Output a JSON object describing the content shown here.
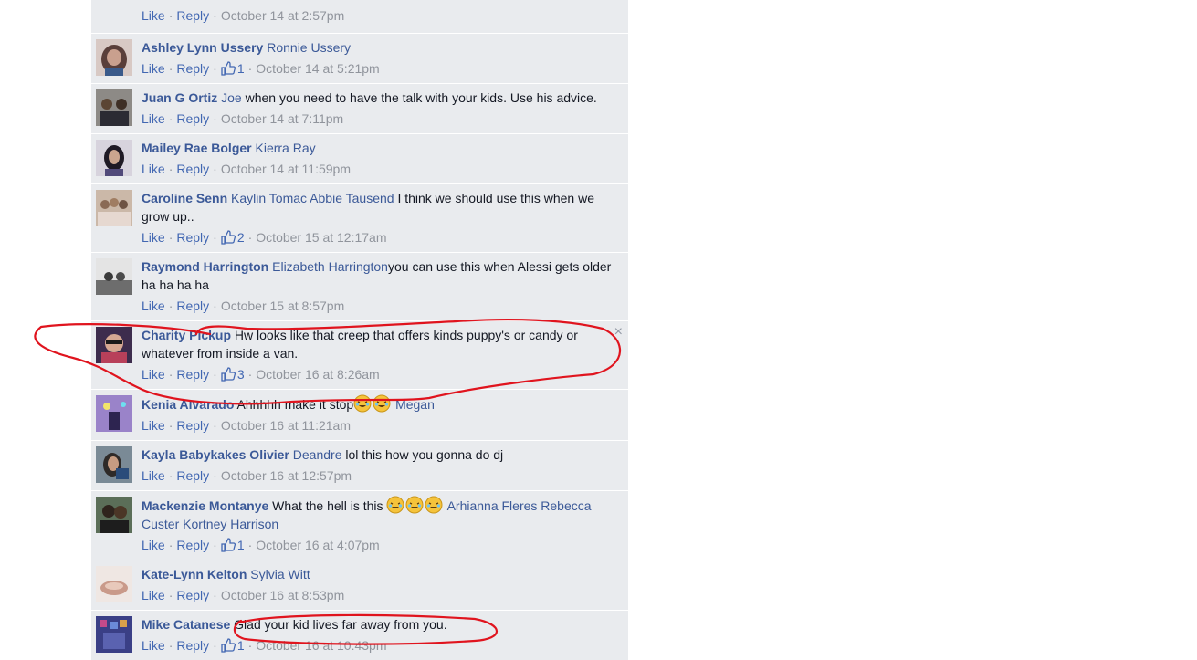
{
  "ui": {
    "like_label": "Like",
    "reply_label": "Reply",
    "separator": "·",
    "close_glyph": "×"
  },
  "comments": [
    {
      "author": "",
      "tags": [],
      "text": "",
      "likes": "",
      "timestamp": "October 14 at 2:57pm"
    },
    {
      "author": "Ashley Lynn Ussery",
      "tags": [
        "Ronnie Ussery"
      ],
      "text": "",
      "likes": "1",
      "timestamp": "October 14 at 5:21pm"
    },
    {
      "author": "Juan G Ortiz",
      "tags": [
        "Joe"
      ],
      "text": "when you need to have the talk with your kids. Use his advice.",
      "likes": "",
      "timestamp": "October 14 at 7:11pm"
    },
    {
      "author": "Mailey Rae Bolger",
      "tags": [
        "Kierra Ray"
      ],
      "text": "",
      "likes": "",
      "timestamp": "October 14 at 11:59pm"
    },
    {
      "author": "Caroline Senn",
      "tags": [
        "Kaylin Tomac",
        "Abbie Tausend"
      ],
      "text": "I think we should use this when we grow up..",
      "likes": "2",
      "timestamp": "October 15 at 12:17am"
    },
    {
      "author": "Raymond Harrington",
      "tags": [
        "Elizabeth Harrington"
      ],
      "text": "you can use this when Alessi gets older ha ha ha ha",
      "likes": "",
      "timestamp": "October 15 at 8:57pm"
    },
    {
      "author": "Charity Pickup",
      "tags": [],
      "text": "Hw looks like that creep that offers kinds puppy's or candy or whatever from inside a van.",
      "likes": "3",
      "timestamp": "October 16 at 8:26am"
    },
    {
      "author": "Kenia Alvarado",
      "tags": [],
      "text": "Ahhhhh make it stop",
      "emoji_count": 2,
      "trailing_tag": "Megan",
      "likes": "",
      "timestamp": "October 16 at 11:21am"
    },
    {
      "author": "Kayla Babykakes Olivier",
      "tags": [
        "Deandre"
      ],
      "text": "lol this how you gonna do dj",
      "likes": "",
      "timestamp": "October 16 at 12:57pm"
    },
    {
      "author": "Mackenzie Montanye",
      "tags": [],
      "text": "What the hell is this",
      "emoji_count": 3,
      "trailing_tags": [
        "Arhianna Fleres",
        "Rebecca Custer",
        "Kortney Harrison"
      ],
      "likes": "1",
      "timestamp": "October 16 at 4:07pm"
    },
    {
      "author": "Kate-Lynn Kelton",
      "tags": [
        "Sylvia Witt"
      ],
      "text": "",
      "likes": "",
      "timestamp": "October 16 at 8:53pm"
    },
    {
      "author": "Mike Catanese",
      "tags": [],
      "text": "Glad your kid lives far away from you.",
      "likes": "1",
      "timestamp": "October 16 at 10:43pm"
    }
  ],
  "colors": {
    "panel_bg": "#e9ebee",
    "author": "#3b5998",
    "link": "#4267b2",
    "meta": "#90949c",
    "annotation": "#e0141e"
  },
  "icons": {
    "like_count": "thumbs-up-icon",
    "emoji": "crying-laughing-emoji",
    "close": "close-icon"
  }
}
